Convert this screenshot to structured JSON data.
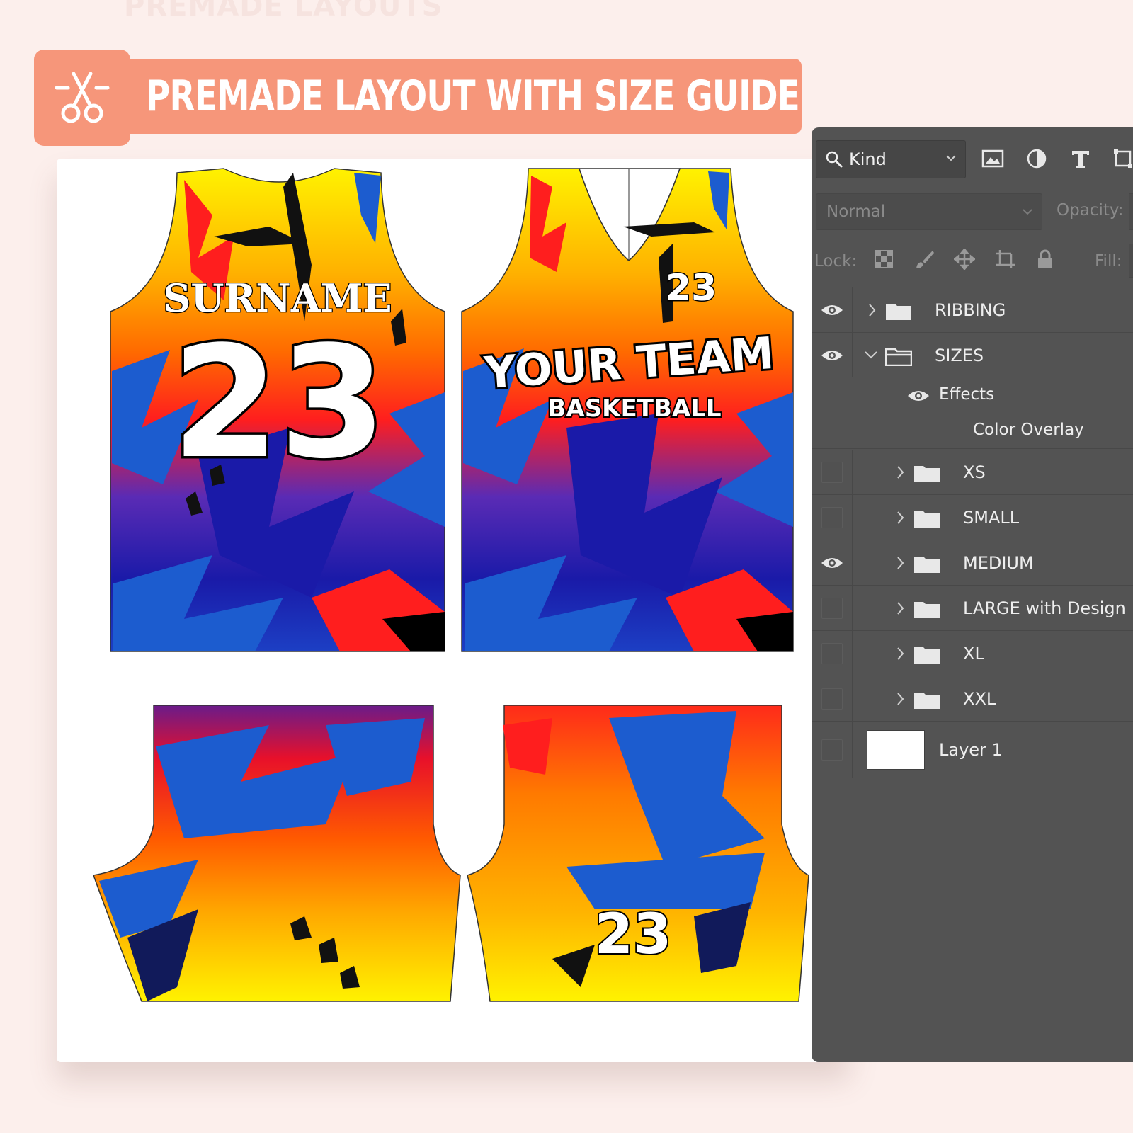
{
  "page": {
    "faded_title": "PREMADE LAYOUTS",
    "banner_title": "PREMADE LAYOUT WITH SIZE GUIDE",
    "banner_icon": "scissors-icon",
    "accent_color": "#f6967a",
    "background_color": "#fcefec"
  },
  "mockup": {
    "front_name": "SURNAME",
    "front_number": "23",
    "back_number": "23",
    "team_line1": "YOUR TEAM",
    "team_line2": "BASKETBALL",
    "shorts_number": "23",
    "colors": [
      "#fff200",
      "#ff9e00",
      "#ff1e1e",
      "#1c5ccf",
      "#1a1aa8",
      "#000000"
    ]
  },
  "layers_panel": {
    "filter_label": "Kind",
    "filter_icons": [
      "image-filter-icon",
      "adjustment-filter-icon",
      "type-filter-icon",
      "shape-filter-icon"
    ],
    "blend_mode": "Normal",
    "opacity_label": "Opacity:",
    "lock_label": "Lock:",
    "lock_icons": [
      "lock-transparent-icon",
      "lock-paint-icon",
      "lock-position-icon",
      "lock-artboard-icon",
      "lock-all-icon"
    ],
    "fill_label": "Fill:",
    "layers": [
      {
        "name": "RIBBING",
        "visible": true,
        "expanded": false
      },
      {
        "name": "SIZES",
        "visible": true,
        "expanded": true
      },
      {
        "name": "XS",
        "visible": false,
        "expanded": false
      },
      {
        "name": "SMALL",
        "visible": false,
        "expanded": false
      },
      {
        "name": "MEDIUM",
        "visible": true,
        "expanded": false
      },
      {
        "name": "LARGE with Design",
        "visible": false,
        "expanded": false
      },
      {
        "name": "XL",
        "visible": false,
        "expanded": false
      },
      {
        "name": "XXL",
        "visible": false,
        "expanded": false
      },
      {
        "name": "Layer 1",
        "visible": false,
        "expanded": false
      }
    ],
    "effects_label": "Effects",
    "effect_name": "Color Overlay"
  }
}
